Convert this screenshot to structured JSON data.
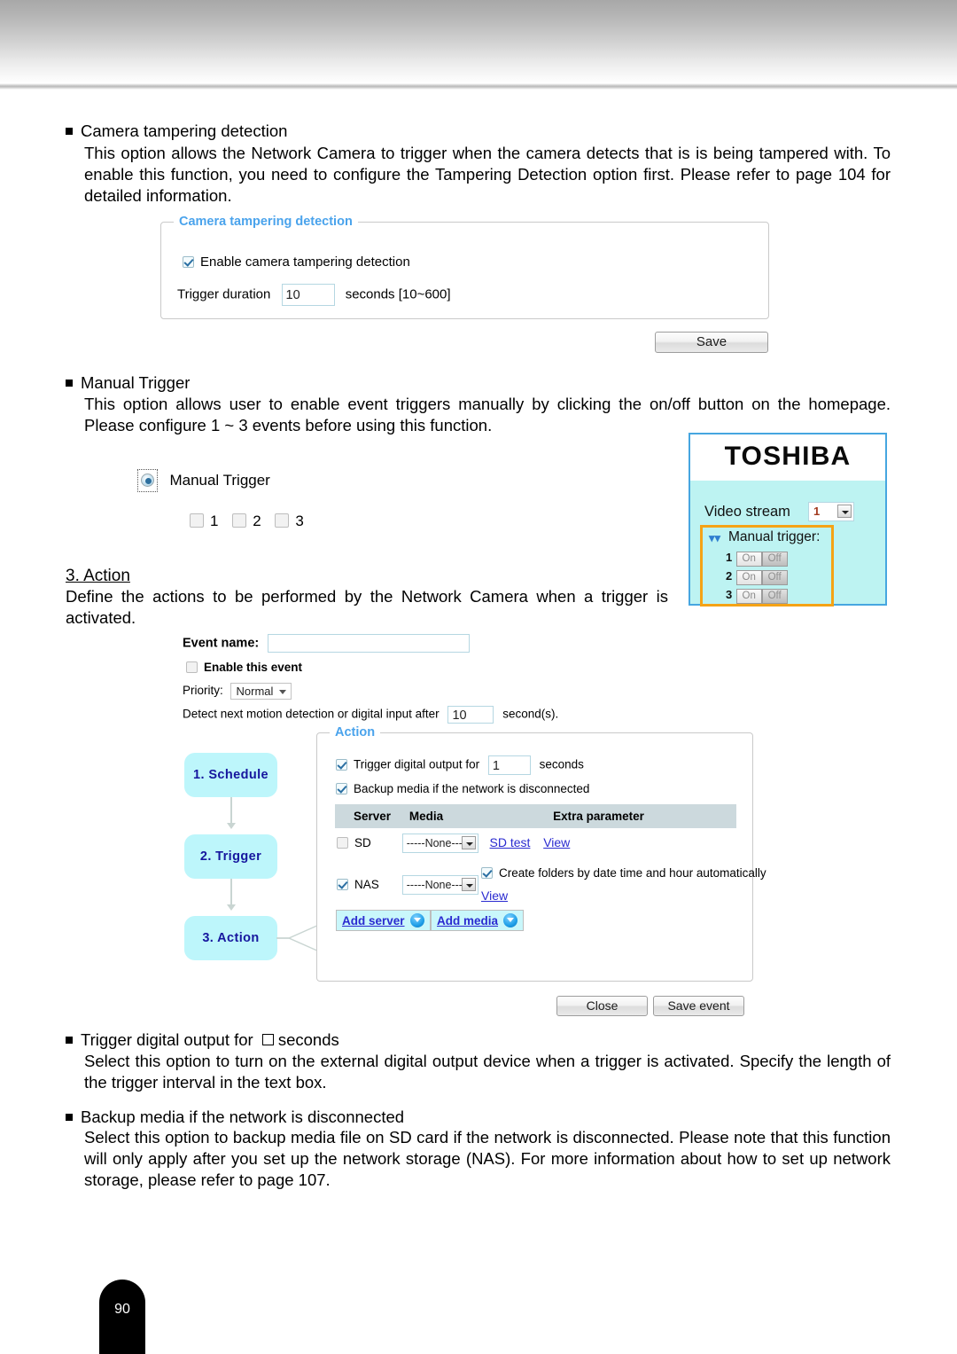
{
  "page": {
    "number": "90"
  },
  "sections": {
    "camera_tampering": {
      "heading": "Camera tampering detection",
      "body": "This option allows the Network Camera to trigger when the camera detects that is is being tampered with. To enable this function, you need to configure the Tampering Detection option first. Please refer to page 104 for detailed information."
    },
    "manual_trigger": {
      "heading": "Manual Trigger",
      "body": "This option allows user to enable event triggers manually by clicking the on/off button on the homepage. Please configure 1 ~ 3 events before using this function."
    },
    "action": {
      "heading": "3. Action",
      "body": "Define the actions to be performed by the Network Camera when a trigger is activated."
    },
    "trigger_digital_output": {
      "heading_a": "Trigger digital output for",
      "heading_b": "seconds",
      "body": "Select this option to turn on the external digital output device when a trigger is activated. Specify the length of the trigger interval in the text box."
    },
    "backup_media": {
      "heading": "Backup media if the network is disconnected",
      "body": "Select this option to backup media file on SD card if the network is disconnected. Please note that this function will only apply after you set up the network storage (NAS). For more information about how to set up network storage, please refer to page 107."
    }
  },
  "tampering_panel": {
    "legend": "Camera tampering detection",
    "enable_label": "Enable camera tampering detection",
    "enable_checked": true,
    "duration_label": "Trigger duration",
    "duration_value": "10",
    "duration_suffix": "seconds [10~600]",
    "save_label": "Save"
  },
  "manual_trigger_widget": {
    "label": "Manual Trigger",
    "checkbox_labels": [
      "1",
      "2",
      "3"
    ]
  },
  "toshiba_panel": {
    "logo": "TOSHIBA",
    "video_stream_label": "Video stream",
    "video_stream_value": "1",
    "manual_trigger_label": "Manual trigger:",
    "rows": [
      {
        "num": "1",
        "on": "On",
        "off": "Off"
      },
      {
        "num": "2",
        "on": "On",
        "off": "Off"
      },
      {
        "num": "3",
        "on": "On",
        "off": "Off"
      }
    ],
    "highlight_color": "#f5a316",
    "border_color": "#46a6e0",
    "background_color": "#bdf3f2"
  },
  "event_dialog": {
    "event_name_label": "Event name:",
    "event_name_value": "",
    "enable_event_label": "Enable this event",
    "enable_event_checked": false,
    "priority_label": "Priority:",
    "priority_value": "Normal",
    "detect_label": "Detect next motion detection or digital input after",
    "detect_value": "10",
    "detect_suffix": "second(s).",
    "steps": [
      {
        "label": "1.  Schedule"
      },
      {
        "label": "2.  Trigger"
      },
      {
        "label": "3.  Action"
      }
    ],
    "action_fieldset": {
      "legend": "Action",
      "trigger_output_label": "Trigger digital output for",
      "trigger_output_value": "1",
      "trigger_output_suffix": "seconds",
      "trigger_output_checked": true,
      "backup_media_label": "Backup media if the network is disconnected",
      "backup_media_checked": true,
      "table_headers": [
        "",
        "Server",
        "Media",
        "Extra parameter"
      ],
      "rows": [
        {
          "checked": false,
          "server": "SD",
          "media": "-----None-----",
          "links": [
            "SD test",
            "View"
          ]
        },
        {
          "checked": true,
          "server": "NAS",
          "media": "-----None-----",
          "extra_checkbox_label": "Create folders by date time and hour automatically",
          "extra_checkbox_checked": true,
          "links": [
            "View"
          ]
        }
      ],
      "add_server_label": "Add server",
      "add_media_label": "Add media"
    },
    "close_label": "Close",
    "save_event_label": "Save event"
  }
}
